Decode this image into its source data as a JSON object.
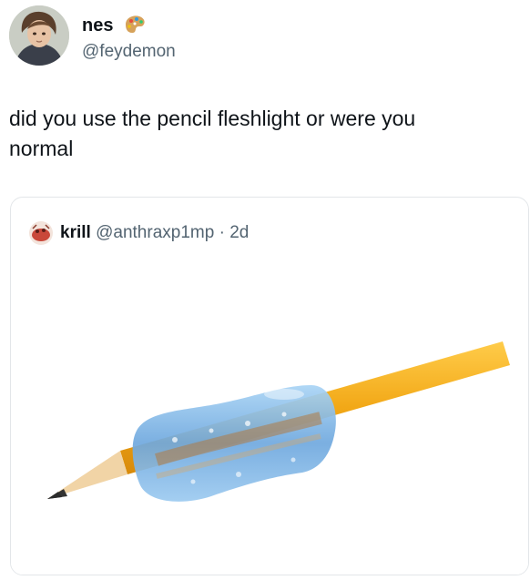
{
  "post": {
    "display_name": "nes",
    "handle": "@feydemon",
    "text_line_1": "did you use the pencil fleshlight or were you",
    "text_line_2": "normal",
    "name_emoji": "artist-palette-icon",
    "avatar": "avatar-anime-character"
  },
  "quoted_post": {
    "display_name": "krill",
    "handle": "@anthraxp1mp",
    "separator": "·",
    "time": "2d",
    "avatar": "avatar-krill",
    "media": "pencil-with-blue-grip-photo"
  },
  "colors": {
    "text": "#0f1419",
    "secondary_text": "#536471",
    "border": "#e3e6e9",
    "pencil": "#f2a817",
    "grip": "#7fb6e8"
  }
}
